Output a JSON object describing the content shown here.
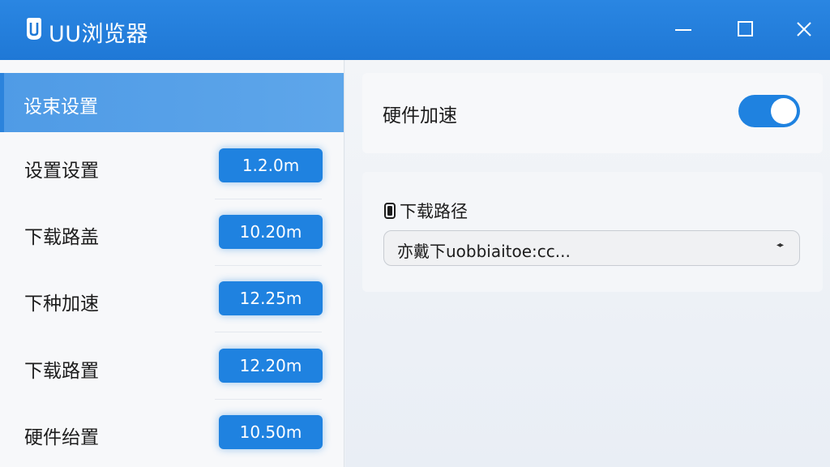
{
  "window": {
    "title": "UU浏览器",
    "logo_icon": "uu-logo-icon",
    "controls": {
      "minimize_icon": "minimize-icon",
      "maximize_icon": "maximize-icon",
      "close_icon": "close-icon"
    }
  },
  "sidebar": {
    "active_item": {
      "label": "设束设置"
    },
    "items": [
      {
        "label": "设置设置",
        "value": "1.2.0m"
      },
      {
        "label": "下载路盖",
        "value": "10.20m"
      },
      {
        "label": "下种加速",
        "value": "12.25m"
      },
      {
        "label": "下载路置",
        "value": "12.20m"
      },
      {
        "label": "硬件绐置",
        "value": "10.50m"
      }
    ]
  },
  "main": {
    "hardware_accel": {
      "label": "硬件加速",
      "enabled": true
    },
    "download_path": {
      "label": "下载路径",
      "icon": "file-icon",
      "value": "亦戴下uobbiaitoe:cc..."
    }
  },
  "colors": {
    "titlebar": "#1f78d6",
    "accent": "#1f82e0",
    "sidebar_active": "#5ea6ea"
  }
}
